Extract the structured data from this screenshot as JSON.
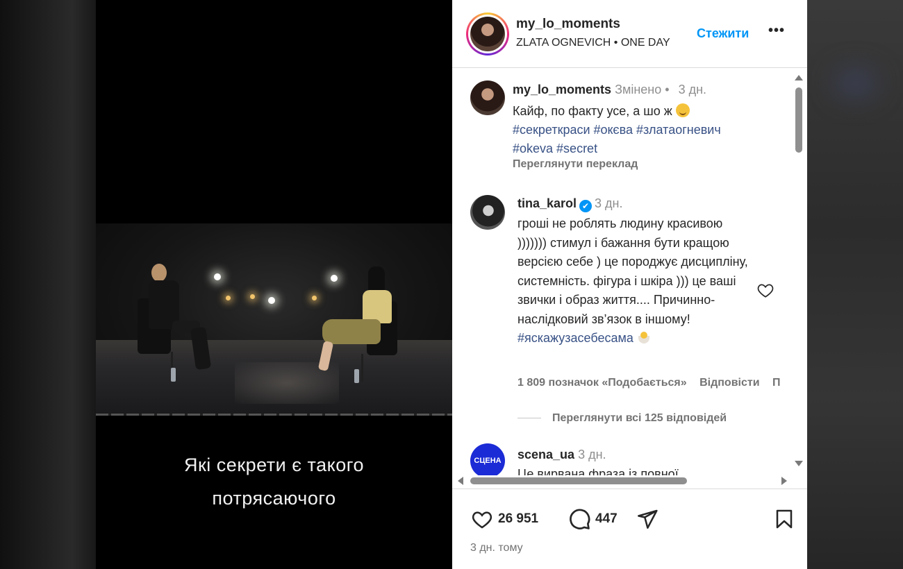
{
  "header": {
    "username": "my_lo_moments",
    "subtitle": "ZLATA OGNEVICH • ONE DAY",
    "follow_label": "Стежити",
    "more_label": "•••"
  },
  "media": {
    "subtitle_line1": "Які секрети є такого",
    "subtitle_line2": "потрясаючого"
  },
  "caption": {
    "username": "my_lo_moments",
    "edited": "Змінено",
    "dot": "•",
    "time": "3 дн.",
    "text": "Кайф, по факту усе, а шо ж",
    "hashtags_line1": "#секреткраси #окєва #златаогневич",
    "hashtags_line2": "#okeva #secret",
    "translate_label": "Переглянути переклад"
  },
  "comments": [
    {
      "username": "tina_karol",
      "verified_icon": "✔",
      "time": "3 дн.",
      "text": "гроші не роблять людину красивою ))))))) стимул і бажання бути кращою версією себе ) це породжує дисципліну, системність. фігура і шкіра ))) це ваші звички і образ життя.... Причинно-наслідковий зв’язок в іншому!",
      "hashtag": "#яскажузасебесама",
      "likes_label": "1 809 позначок «Подобається»",
      "reply_label": "Відповісти",
      "truncated_label": "П",
      "view_replies_label": "Переглянути всі 125 відповідей"
    },
    {
      "username": "scena_ua",
      "avatar_text": "СЦЕНА",
      "time": "3 дн.",
      "text": "Це вирвана фраза із повної"
    }
  ],
  "actions": {
    "likes_count": "26 951",
    "comments_count": "447",
    "time_ago": "3 дн. тому"
  },
  "colors": {
    "link": "#0095f6",
    "hashtag": "#385185",
    "muted": "#737373",
    "text": "#262626"
  }
}
